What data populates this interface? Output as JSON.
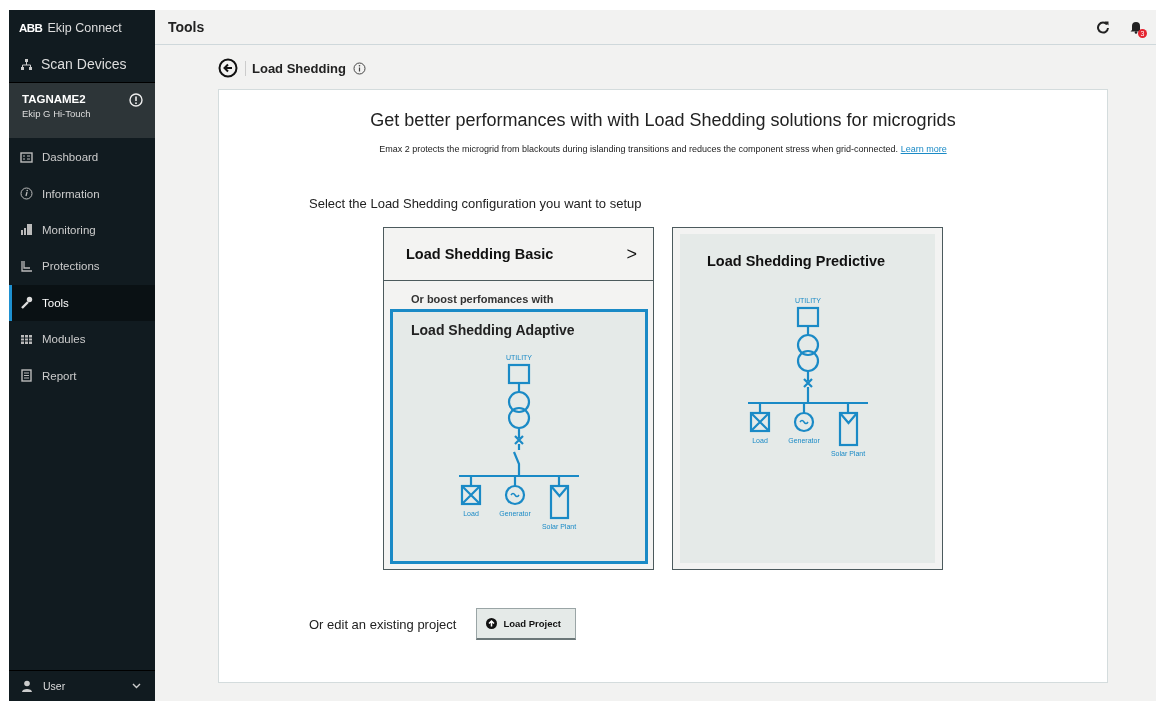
{
  "app": {
    "brand": "ABB",
    "name": "Ekip Connect"
  },
  "sidebar": {
    "scan": "Scan Devices",
    "device": {
      "tag": "TAGNAME2",
      "model": "Ekip G Hi-Touch"
    },
    "items": [
      {
        "label": "Dashboard",
        "kind": "dashboard",
        "selected": false
      },
      {
        "label": "Information",
        "kind": "info",
        "selected": false
      },
      {
        "label": "Monitoring",
        "kind": "bars",
        "selected": false
      },
      {
        "label": "Protections",
        "kind": "curve",
        "selected": false
      },
      {
        "label": "Tools",
        "kind": "wrench",
        "selected": true
      },
      {
        "label": "Modules",
        "kind": "grid",
        "selected": false
      },
      {
        "label": "Report",
        "kind": "doc",
        "selected": false
      }
    ],
    "user": "User"
  },
  "header": {
    "title": "Tools",
    "notifications": "3"
  },
  "breadcrumb": {
    "title": "Load Shedding"
  },
  "card": {
    "heading": "Get better performances with with Load Shedding solutions for microgrids",
    "description": "Emax 2 protects the microgrid from blackouts during islanding transitions and reduces the component stress  when grid-connected.",
    "link": "Learn more",
    "prompt": "Select the Load Shedding configuration you want to setup",
    "basic": {
      "title": "Load Shedding Basic",
      "chevron": ">"
    },
    "boost": "Or boost perfomances with",
    "options": [
      {
        "title": "Load Shedding Adaptive",
        "selected": true,
        "switch": true,
        "labels": [
          "UTILITY",
          "Load",
          "Generator",
          "Solar Plant"
        ]
      },
      {
        "title": "Load Shedding Predictive",
        "selected": false,
        "switch": false,
        "labels": [
          "UTILITY",
          "Load",
          "Generator",
          "Solar Plant"
        ]
      }
    ],
    "edit_prompt": "Or edit an existing project",
    "load_button": "Load Project"
  }
}
